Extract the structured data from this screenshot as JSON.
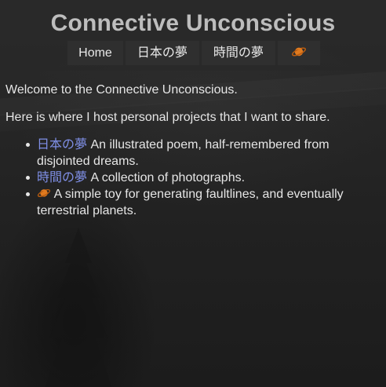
{
  "site": {
    "title": "Connective Unconscious"
  },
  "nav": {
    "items": [
      {
        "label": "Home"
      },
      {
        "label": "日本の夢"
      },
      {
        "label": "時間の夢"
      },
      {
        "icon": "ringed-planet-icon"
      }
    ]
  },
  "main": {
    "welcome": "Welcome to the Connective Unconscious.",
    "intro": "Here is where I host personal projects that I want to share.",
    "projects": [
      {
        "link": "日本の夢",
        "description": "An illustrated poem, half-remembered from disjointed dreams."
      },
      {
        "link": "時間の夢",
        "description": "A collection of photographs."
      },
      {
        "link_icon": "ringed-planet-icon",
        "description": "A simple toy for generating faultlines, and eventually terrestrial planets."
      }
    ]
  },
  "colors": {
    "background": "#232323",
    "header_title": "#bdbdbd",
    "nav_button": "#2f2f2f",
    "text": "#e6e6e6",
    "link": "#7f8fe6",
    "planet": "#e07a1f"
  }
}
